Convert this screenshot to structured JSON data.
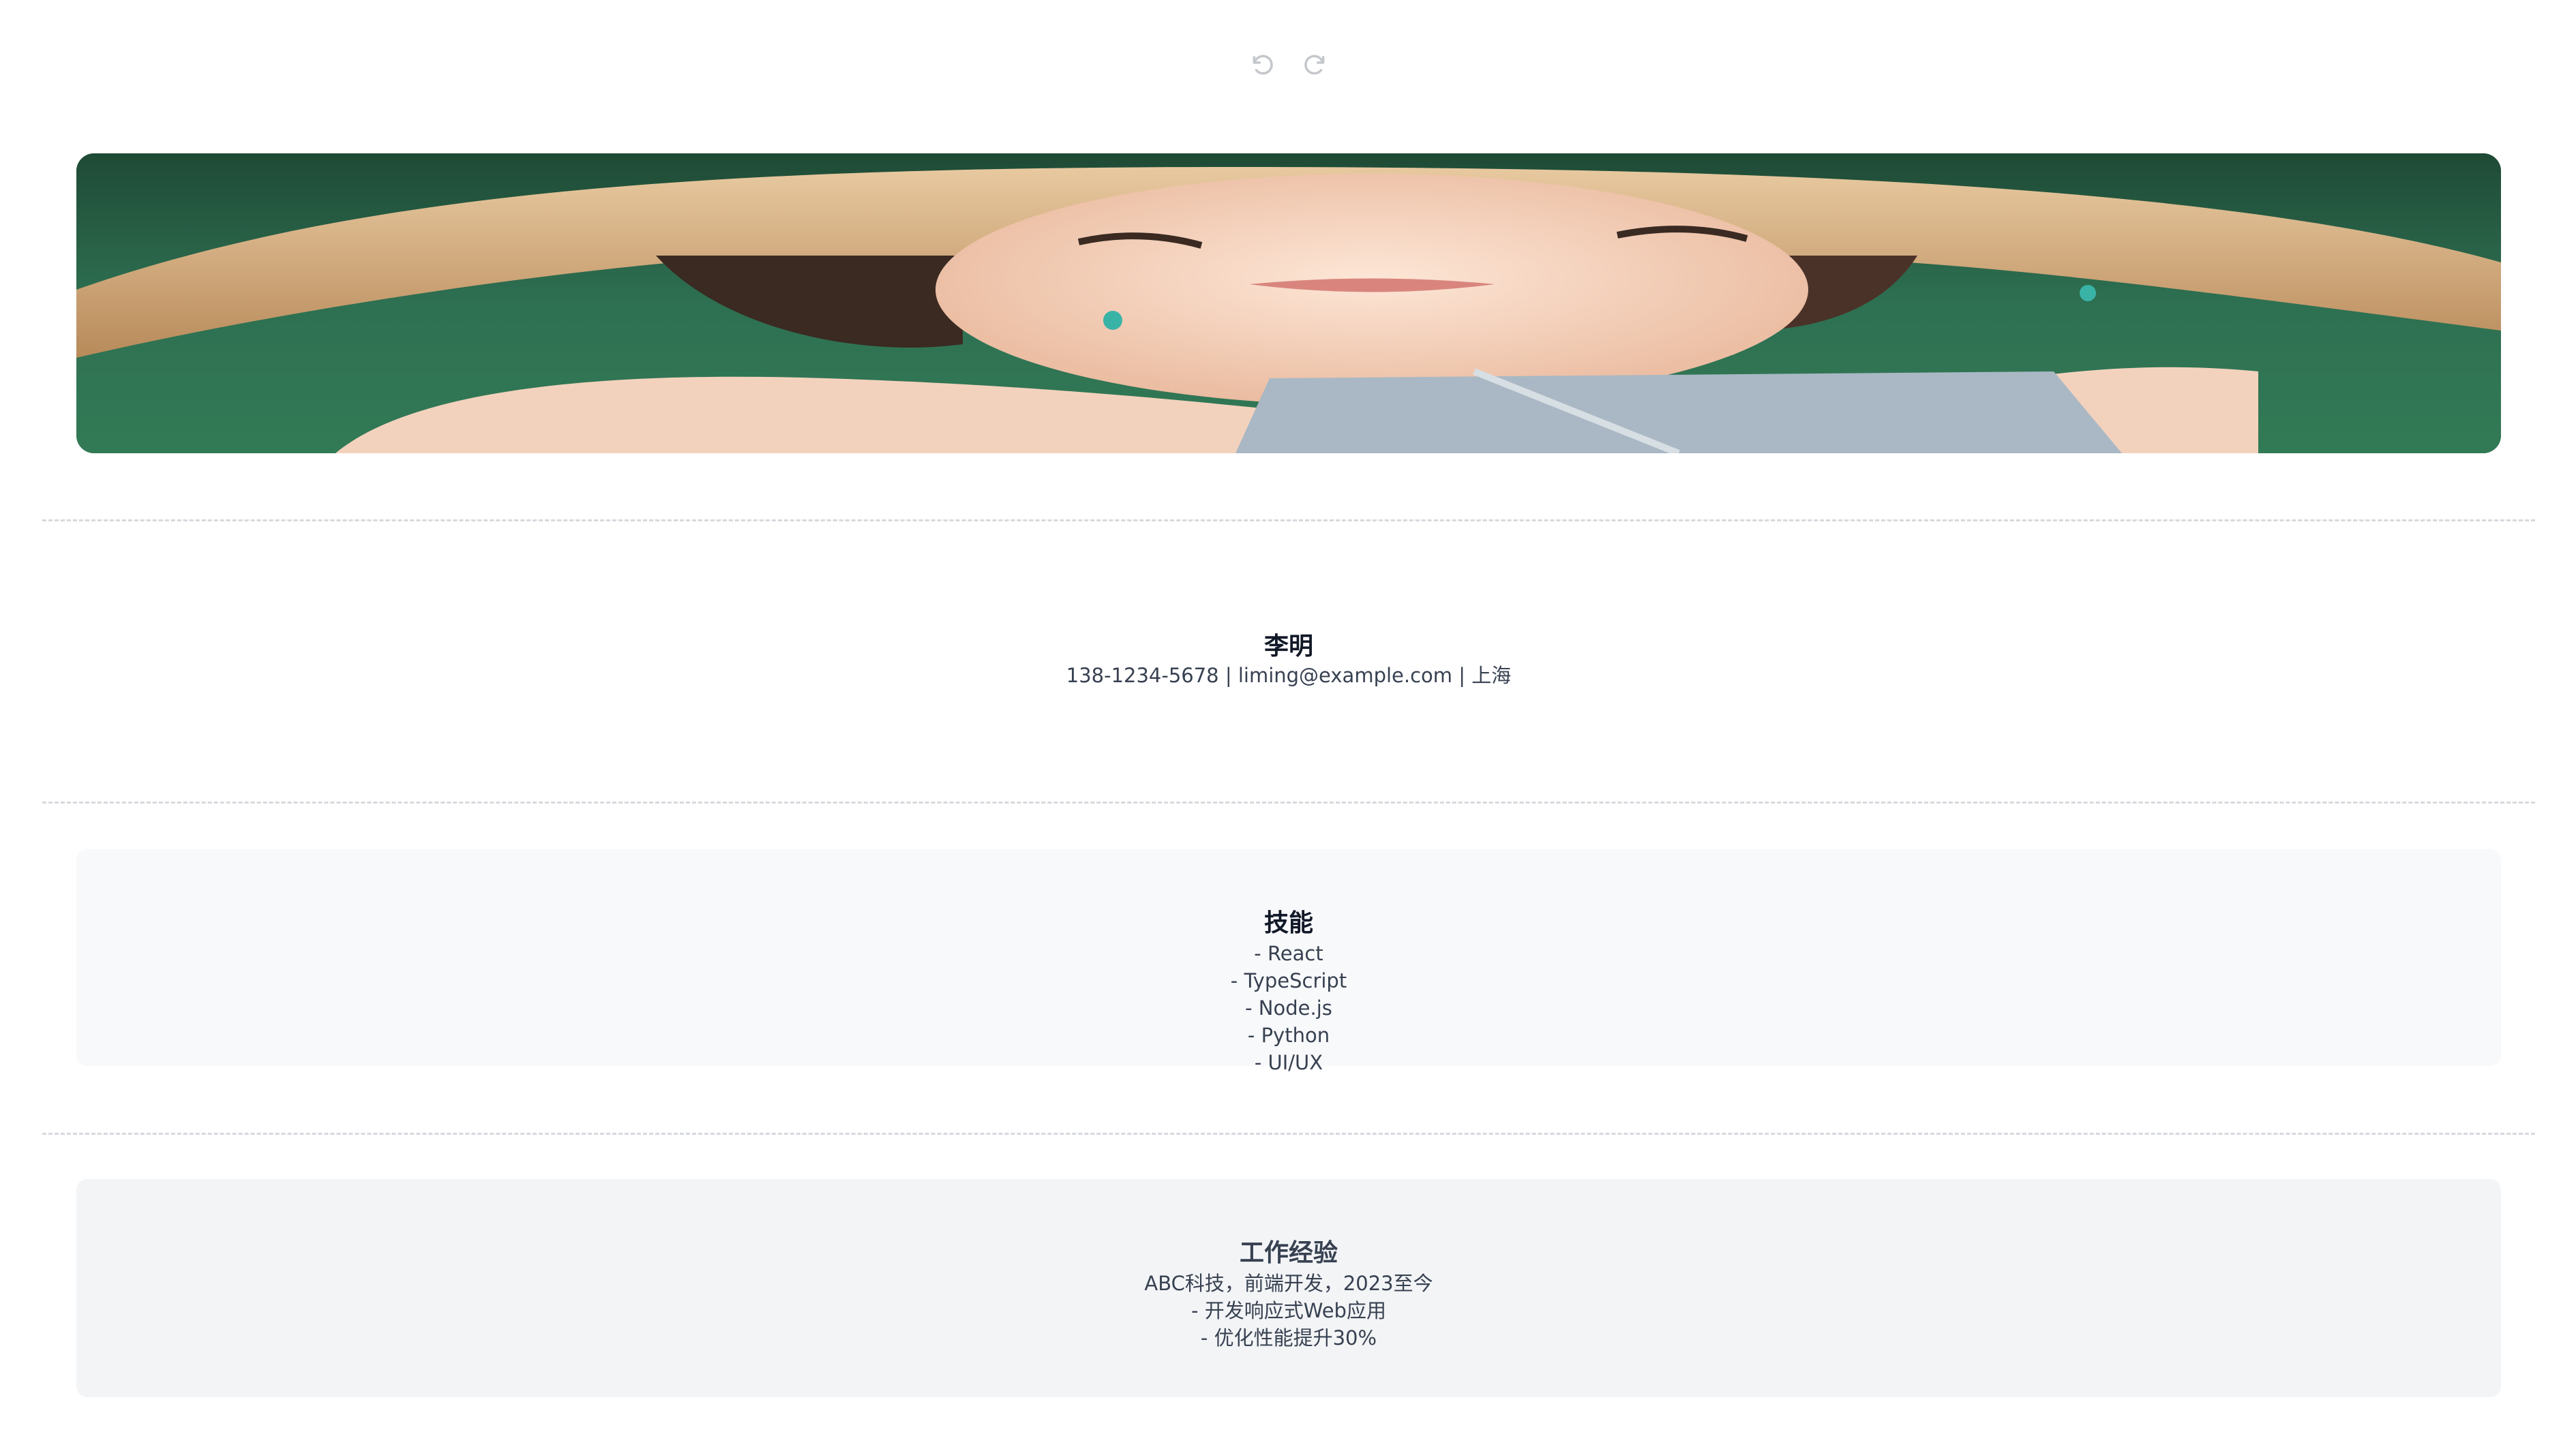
{
  "toolbar": {
    "undo_icon": "undo-icon",
    "redo_icon": "redo-icon"
  },
  "banner": {
    "alt": "photo-banner"
  },
  "profile": {
    "name": "李明",
    "contact": "138-1234-5678 | liming@example.com | 上海"
  },
  "skills": {
    "title": "技能",
    "items": [
      "- React",
      "- TypeScript",
      "- Node.js",
      "- Python",
      "- UI/UX"
    ]
  },
  "experience": {
    "title": "工作经验",
    "lines": [
      "ABC科技，前端开发，2023至今",
      "- 开发响应式Web应用",
      "- 优化性能提升30%"
    ]
  },
  "colors": {
    "divider": "#d6d9de",
    "skills_card": "#f8f9fb",
    "experience_card": "#f3f4f6",
    "title": "#111827",
    "text": "#374151",
    "icon": "#c4c7cc"
  }
}
